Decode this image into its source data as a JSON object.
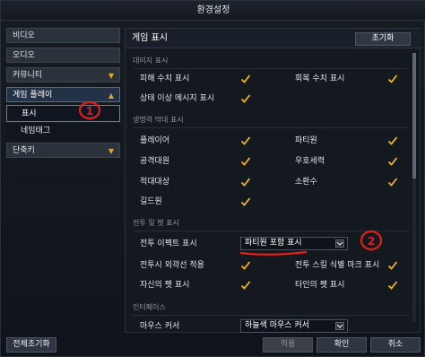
{
  "window": {
    "title": "환경설정"
  },
  "nav": {
    "items": [
      {
        "label": "비디오"
      },
      {
        "label": "오디오"
      },
      {
        "label": "커뮤니티"
      },
      {
        "label": "게임 플레이"
      },
      {
        "label": "단축키"
      }
    ],
    "subitems": [
      {
        "label": "표시"
      },
      {
        "label": "네임태그"
      }
    ]
  },
  "content": {
    "title": "게임 표시",
    "reset_label": "초기화",
    "sections": [
      {
        "header": "대미지 표시",
        "options": [
          {
            "label": "피해 수치 표시",
            "checked": true
          },
          {
            "label": "회복 수치 표시",
            "checked": true
          },
          {
            "label": "상태 이상 메시지 표시",
            "checked": true
          }
        ]
      },
      {
        "header": "생명력 막대 표시",
        "options": [
          {
            "label": "플레이어",
            "checked": true
          },
          {
            "label": "파티원",
            "checked": true
          },
          {
            "label": "공격대원",
            "checked": true
          },
          {
            "label": "우호세력",
            "checked": true
          },
          {
            "label": "적대대상",
            "checked": true
          },
          {
            "label": "소환수",
            "checked": true
          },
          {
            "label": "길드원",
            "checked": true
          }
        ]
      },
      {
        "header": "전투 및 펫 표시",
        "options": [
          {
            "label": "전투 이펙트 표시",
            "value": "파티원 포함 표시"
          },
          {
            "label": "전투시 외곽선 적용",
            "checked": true
          },
          {
            "label": "전투 스킬 식별 마크 표시",
            "checked": true
          },
          {
            "label": "자신의 펫 표시",
            "checked": true
          },
          {
            "label": "타인의 펫 표시",
            "checked": true
          }
        ]
      },
      {
        "header": "인터페이스",
        "options": [
          {
            "label": "마우스 커서",
            "value": "하늘색 마우스 커서"
          }
        ]
      }
    ]
  },
  "footer": {
    "reset_all_label": "전체초기화",
    "apply_label": "적용",
    "ok_label": "확인",
    "cancel_label": "취소"
  },
  "annotations": {
    "marker_1": "1",
    "marker_2": "2",
    "color": "#e0201b"
  },
  "colors": {
    "check": "#f0b323",
    "accent_border": "#5c82b4"
  }
}
